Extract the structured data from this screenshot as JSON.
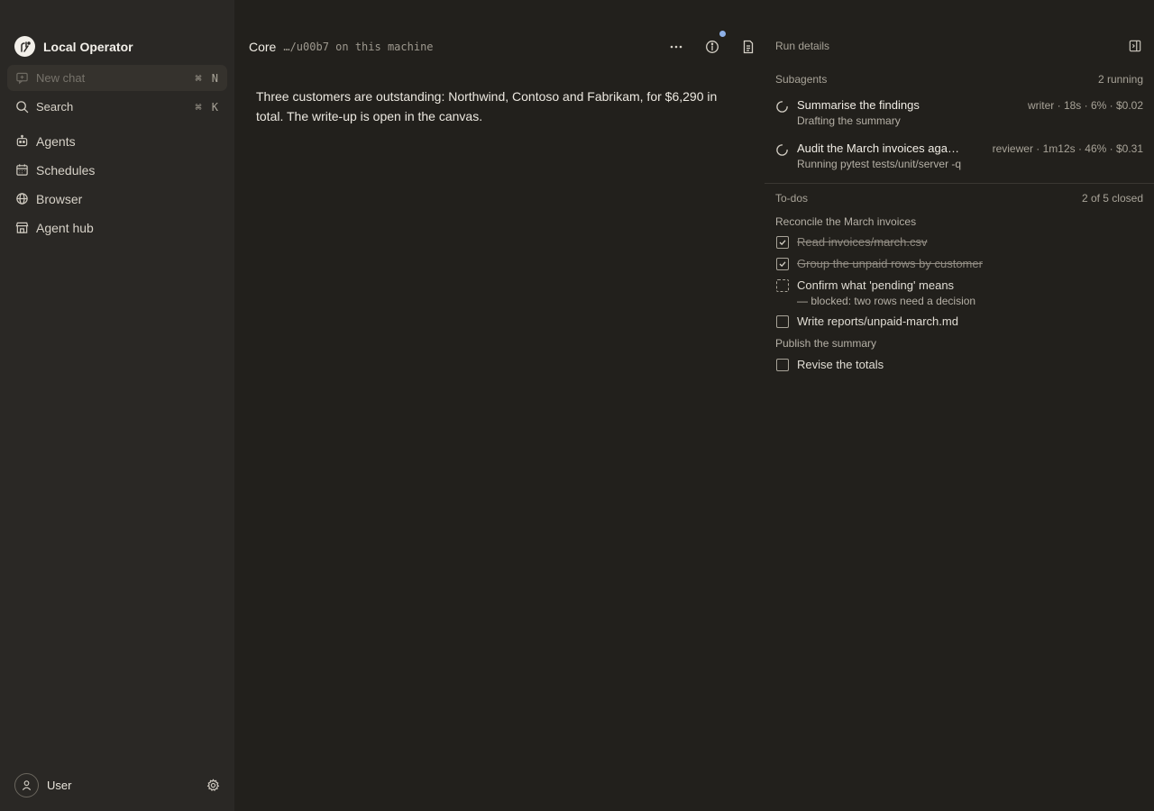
{
  "sidebar": {
    "app_name": "Local Operator",
    "new_chat": {
      "label": "New chat",
      "shortcut": "⌘ N"
    },
    "search": {
      "label": "Search",
      "shortcut": "⌘ K"
    },
    "nav": [
      {
        "label": "Agents",
        "icon": "robot-icon"
      },
      {
        "label": "Schedules",
        "icon": "calendar-icon"
      },
      {
        "label": "Browser",
        "icon": "globe-icon"
      },
      {
        "label": "Agent hub",
        "icon": "store-icon"
      }
    ],
    "user": {
      "name": "User"
    }
  },
  "main": {
    "title": "Core",
    "path": "…/u00b7 on this machine",
    "message": "Three customers are outstanding: Northwind, Contoso and Fabrikam, for $6,290 in total. The write-up is open in the canvas."
  },
  "panel": {
    "title": "Run details",
    "subagents": {
      "heading": "Subagents",
      "status": "2 running",
      "items": [
        {
          "name": "Summarise the findings",
          "meta": "writer · 18s · 6% · $0.02",
          "desc": "Drafting the summary"
        },
        {
          "name": "Audit the March invoices against the ledger",
          "meta": "reviewer · 1m12s · 46% · $0.31",
          "desc": "Running pytest tests/unit/server -q"
        }
      ]
    },
    "todos": {
      "heading": "To-dos",
      "status": "2 of 5 closed",
      "groups": [
        {
          "label": "Reconcile the March invoices",
          "items": [
            {
              "text": "Read invoices/march.csv",
              "state": "done"
            },
            {
              "text": "Group the unpaid rows by customer",
              "state": "done"
            },
            {
              "text": "Confirm what 'pending' means",
              "state": "blocked",
              "note": "— blocked: two rows need a decision"
            },
            {
              "text": "Write reports/unpaid-march.md",
              "state": "open"
            }
          ]
        },
        {
          "label": "Publish the summary",
          "items": [
            {
              "text": "Revise the totals",
              "state": "open"
            }
          ]
        }
      ]
    }
  },
  "colors": {
    "background": "#22201c",
    "sidebar": "#2a2825",
    "accent_dot": "#8fb1e8"
  }
}
